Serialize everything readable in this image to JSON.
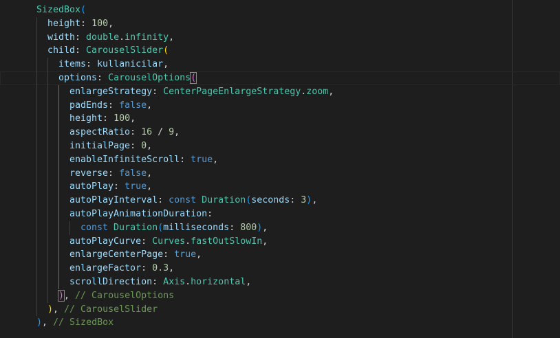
{
  "editor": {
    "language": "dart",
    "colors": {
      "background": "#1e1e1e",
      "property": "#9cdcfe",
      "class": "#4ec9b0",
      "number": "#b5cea8",
      "keyword": "#569cd6",
      "punctuation": "#d4d4d4",
      "comment": "#6a9955",
      "bracket_level_1": "#ffd700",
      "bracket_level_2": "#da70d6",
      "bracket_level_3": "#179fff"
    },
    "lines": [
      {
        "indent": 0,
        "tokens": [
          {
            "t": "SizedBox",
            "c": "class"
          },
          {
            "t": "(",
            "c": "br3"
          }
        ]
      },
      {
        "indent": 1,
        "tokens": [
          {
            "t": "height",
            "c": "prop"
          },
          {
            "t": ": ",
            "c": "punc"
          },
          {
            "t": "100",
            "c": "num"
          },
          {
            "t": ",",
            "c": "punc"
          }
        ]
      },
      {
        "indent": 1,
        "tokens": [
          {
            "t": "width",
            "c": "prop"
          },
          {
            "t": ": ",
            "c": "punc"
          },
          {
            "t": "double",
            "c": "class"
          },
          {
            "t": ".",
            "c": "punc"
          },
          {
            "t": "infinity",
            "c": "class"
          },
          {
            "t": ",",
            "c": "punc"
          }
        ]
      },
      {
        "indent": 1,
        "tokens": [
          {
            "t": "child",
            "c": "prop"
          },
          {
            "t": ": ",
            "c": "punc"
          },
          {
            "t": "CarouselSlider",
            "c": "class"
          },
          {
            "t": "(",
            "c": "br1"
          }
        ]
      },
      {
        "indent": 2,
        "tokens": [
          {
            "t": "items",
            "c": "prop"
          },
          {
            "t": ": ",
            "c": "punc"
          },
          {
            "t": "kullanicilar",
            "c": "prop"
          },
          {
            "t": ",",
            "c": "punc"
          }
        ]
      },
      {
        "indent": 2,
        "current": true,
        "tokens": [
          {
            "t": "options",
            "c": "prop"
          },
          {
            "t": ": ",
            "c": "punc"
          },
          {
            "t": "CarouselOptions",
            "c": "class"
          },
          {
            "t": "(",
            "c": "br2",
            "match": true
          }
        ]
      },
      {
        "indent": 3,
        "tokens": [
          {
            "t": "enlargeStrategy",
            "c": "prop"
          },
          {
            "t": ": ",
            "c": "punc"
          },
          {
            "t": "CenterPageEnlargeStrategy",
            "c": "class"
          },
          {
            "t": ".",
            "c": "punc"
          },
          {
            "t": "zoom",
            "c": "class"
          },
          {
            "t": ",",
            "c": "punc"
          }
        ]
      },
      {
        "indent": 3,
        "tokens": [
          {
            "t": "padEnds",
            "c": "prop"
          },
          {
            "t": ": ",
            "c": "punc"
          },
          {
            "t": "false",
            "c": "kw"
          },
          {
            "t": ",",
            "c": "punc"
          }
        ]
      },
      {
        "indent": 3,
        "tokens": [
          {
            "t": "height",
            "c": "prop"
          },
          {
            "t": ": ",
            "c": "punc"
          },
          {
            "t": "100",
            "c": "num"
          },
          {
            "t": ",",
            "c": "punc"
          }
        ]
      },
      {
        "indent": 3,
        "tokens": [
          {
            "t": "aspectRatio",
            "c": "prop"
          },
          {
            "t": ": ",
            "c": "punc"
          },
          {
            "t": "16",
            "c": "num"
          },
          {
            "t": " / ",
            "c": "punc"
          },
          {
            "t": "9",
            "c": "num"
          },
          {
            "t": ",",
            "c": "punc"
          }
        ]
      },
      {
        "indent": 3,
        "tokens": [
          {
            "t": "initialPage",
            "c": "prop"
          },
          {
            "t": ": ",
            "c": "punc"
          },
          {
            "t": "0",
            "c": "num"
          },
          {
            "t": ",",
            "c": "punc"
          }
        ]
      },
      {
        "indent": 3,
        "tokens": [
          {
            "t": "enableInfiniteScroll",
            "c": "prop"
          },
          {
            "t": ": ",
            "c": "punc"
          },
          {
            "t": "true",
            "c": "kw"
          },
          {
            "t": ",",
            "c": "punc"
          }
        ]
      },
      {
        "indent": 3,
        "tokens": [
          {
            "t": "reverse",
            "c": "prop"
          },
          {
            "t": ": ",
            "c": "punc"
          },
          {
            "t": "false",
            "c": "kw"
          },
          {
            "t": ",",
            "c": "punc"
          }
        ]
      },
      {
        "indent": 3,
        "tokens": [
          {
            "t": "autoPlay",
            "c": "prop"
          },
          {
            "t": ": ",
            "c": "punc"
          },
          {
            "t": "true",
            "c": "kw"
          },
          {
            "t": ",",
            "c": "punc"
          }
        ]
      },
      {
        "indent": 3,
        "tokens": [
          {
            "t": "autoPlayInterval",
            "c": "prop"
          },
          {
            "t": ": ",
            "c": "punc"
          },
          {
            "t": "const",
            "c": "kw"
          },
          {
            "t": " ",
            "c": "punc"
          },
          {
            "t": "Duration",
            "c": "class"
          },
          {
            "t": "(",
            "c": "br3"
          },
          {
            "t": "seconds",
            "c": "prop"
          },
          {
            "t": ": ",
            "c": "punc"
          },
          {
            "t": "3",
            "c": "num"
          },
          {
            "t": ")",
            "c": "br3"
          },
          {
            "t": ",",
            "c": "punc"
          }
        ]
      },
      {
        "indent": 3,
        "tokens": [
          {
            "t": "autoPlayAnimationDuration",
            "c": "prop"
          },
          {
            "t": ":",
            "c": "punc"
          }
        ]
      },
      {
        "indent": 4,
        "tokens": [
          {
            "t": "const",
            "c": "kw"
          },
          {
            "t": " ",
            "c": "punc"
          },
          {
            "t": "Duration",
            "c": "class"
          },
          {
            "t": "(",
            "c": "br3"
          },
          {
            "t": "milliseconds",
            "c": "prop"
          },
          {
            "t": ": ",
            "c": "punc"
          },
          {
            "t": "800",
            "c": "num"
          },
          {
            "t": ")",
            "c": "br3"
          },
          {
            "t": ",",
            "c": "punc"
          }
        ]
      },
      {
        "indent": 3,
        "tokens": [
          {
            "t": "autoPlayCurve",
            "c": "prop"
          },
          {
            "t": ": ",
            "c": "punc"
          },
          {
            "t": "Curves",
            "c": "class"
          },
          {
            "t": ".",
            "c": "punc"
          },
          {
            "t": "fastOutSlowIn",
            "c": "class"
          },
          {
            "t": ",",
            "c": "punc"
          }
        ]
      },
      {
        "indent": 3,
        "tokens": [
          {
            "t": "enlargeCenterPage",
            "c": "prop"
          },
          {
            "t": ": ",
            "c": "punc"
          },
          {
            "t": "true",
            "c": "kw"
          },
          {
            "t": ",",
            "c": "punc"
          }
        ]
      },
      {
        "indent": 3,
        "tokens": [
          {
            "t": "enlargeFactor",
            "c": "prop"
          },
          {
            "t": ": ",
            "c": "punc"
          },
          {
            "t": "0.3",
            "c": "num"
          },
          {
            "t": ",",
            "c": "punc"
          }
        ]
      },
      {
        "indent": 3,
        "tokens": [
          {
            "t": "scrollDirection",
            "c": "prop"
          },
          {
            "t": ": ",
            "c": "punc"
          },
          {
            "t": "Axis",
            "c": "class"
          },
          {
            "t": ".",
            "c": "punc"
          },
          {
            "t": "horizontal",
            "c": "class"
          },
          {
            "t": ",",
            "c": "punc"
          }
        ]
      },
      {
        "indent": 2,
        "tokens": [
          {
            "t": ")",
            "c": "br2",
            "match": true
          },
          {
            "t": ", ",
            "c": "punc"
          },
          {
            "t": "// CarouselOptions",
            "c": "comment"
          }
        ]
      },
      {
        "indent": 1,
        "tokens": [
          {
            "t": ")",
            "c": "br1"
          },
          {
            "t": ", ",
            "c": "punc"
          },
          {
            "t": "// CarouselSlider",
            "c": "comment"
          }
        ]
      },
      {
        "indent": 0,
        "tokens": [
          {
            "t": ")",
            "c": "br3"
          },
          {
            "t": ", ",
            "c": "punc"
          },
          {
            "t": "// SizedBox",
            "c": "comment"
          }
        ]
      }
    ]
  }
}
